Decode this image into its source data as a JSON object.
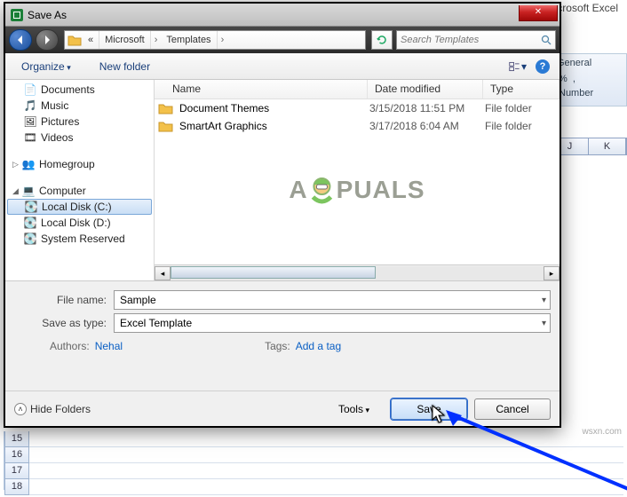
{
  "excel": {
    "title": "Microsoft Excel",
    "group_general": "General",
    "number_label": "Number",
    "percent": "%",
    "comma": ",",
    "cols": [
      "J",
      "K"
    ],
    "rows": [
      "15",
      "16",
      "17",
      "18"
    ]
  },
  "dialog": {
    "title": "Save As",
    "breadcrumb": {
      "root_sep": "«",
      "p1": "Microsoft",
      "p2": "Templates"
    },
    "search": {
      "placeholder": "Search Templates"
    },
    "toolbar": {
      "organize": "Organize",
      "newfolder": "New folder"
    },
    "tree": {
      "documents": "Documents",
      "music": "Music",
      "pictures": "Pictures",
      "videos": "Videos",
      "homegroup": "Homegroup",
      "computer": "Computer",
      "c": "Local Disk (C:)",
      "d": "Local Disk (D:)",
      "sysres": "System Reserved"
    },
    "columns": {
      "name": "Name",
      "date": "Date modified",
      "type": "Type"
    },
    "files": [
      {
        "name": "Document Themes",
        "date": "3/15/2018 11:51 PM",
        "type": "File folder"
      },
      {
        "name": "SmartArt Graphics",
        "date": "3/17/2018 6:04 AM",
        "type": "File folder"
      }
    ],
    "form": {
      "filename_label": "File name:",
      "filename_value": "Sample",
      "type_label": "Save as type:",
      "type_value": "Excel Template",
      "authors_label": "Authors:",
      "authors_value": "Nehal",
      "tags_label": "Tags:",
      "tags_value": "Add a tag"
    },
    "footer": {
      "hide": "Hide Folders",
      "tools": "Tools",
      "save": "Save",
      "cancel": "Cancel"
    }
  },
  "watermark": {
    "a": "A",
    "puals": "PUALS"
  },
  "wsxn": "wsxn.com"
}
